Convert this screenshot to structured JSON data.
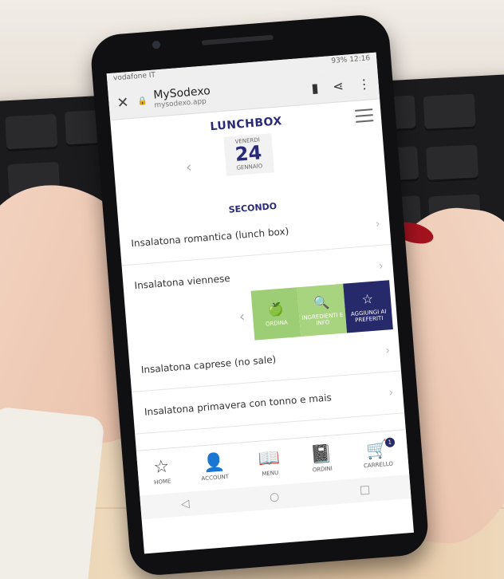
{
  "status": {
    "carrier": "vodafone IT",
    "right": "93%",
    "time": "12:16"
  },
  "browser": {
    "title": "MySodexo",
    "url": "mysodexo.app"
  },
  "app": {
    "title": "LUNCHBOX",
    "date": {
      "weekday": "VENERDI",
      "day": "24",
      "month": "GENNAIO"
    },
    "section": "SECONDO",
    "items": [
      "Insalatona romantica (lunch box)",
      "Insalatona viennese",
      "Insalatona caprese (no sale)",
      "Insalatona primavera con tonno e mais"
    ],
    "actions": {
      "ordina": "ORDINA",
      "ingredienti": "INGREDIENTI E INFO",
      "preferiti": "AGGIUNGI AI PREFERITI"
    }
  },
  "nav": {
    "home": "HOME",
    "account": "ACCOUNT",
    "menu": "MENU",
    "ordini": "ORDINI",
    "carrello": "CARRELLO",
    "cart_count": "1"
  }
}
